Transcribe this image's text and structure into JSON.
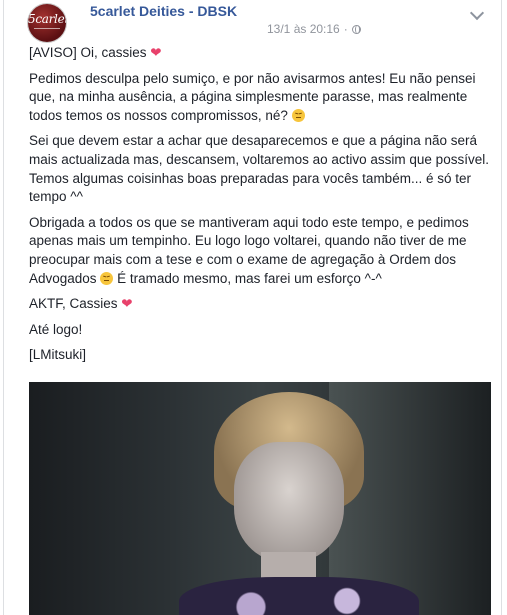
{
  "post": {
    "page_name": "5carlet Deities - DBSK",
    "avatar_text": "5carlet",
    "timestamp": "13/1 às 20:16",
    "separator": "·",
    "paragraphs": [
      {
        "text": "[AVISO] Oi, cassies ",
        "emoji": "heart"
      },
      {
        "text": "Pedimos desculpa pelo sumiço, e por não avisarmos antes! Eu não pensei que, na minha ausência, a página simplesmente parasse, mas realmente todos temos os nossos compromissos, né? ",
        "emoji": "face"
      },
      {
        "text": "Sei que devem estar a achar que desaparecemos e que a página não será mais actualizada mas, descansem, voltaremos ao activo assim que possível. Temos algumas coisinhas boas preparadas para vocês também... é só ter tempo ^^"
      },
      {
        "text": "Obrigada a todos os que se mantiveram aqui todo este tempo, e pedimos apenas mais um tempinho. Eu logo logo voltarei, quando não tiver de me preocupar mais com a tese e com o exame de agregação à Ordem dos Advogados ",
        "emoji": "face",
        "text_after": " É tramado mesmo, mas farei um esforço ^-^"
      },
      {
        "text": "AKTF, Cassies ",
        "emoji": "heart"
      },
      {
        "text": "Até logo!"
      },
      {
        "text": "[LMitsuki]"
      }
    ]
  },
  "icons": {
    "heart": "heart-icon",
    "face": "persevering-face-icon",
    "globe": "globe-icon",
    "menu": "chevron-down-icon"
  },
  "colors": {
    "link": "#365899",
    "meta": "#90949c",
    "heart": "#e8416b"
  }
}
